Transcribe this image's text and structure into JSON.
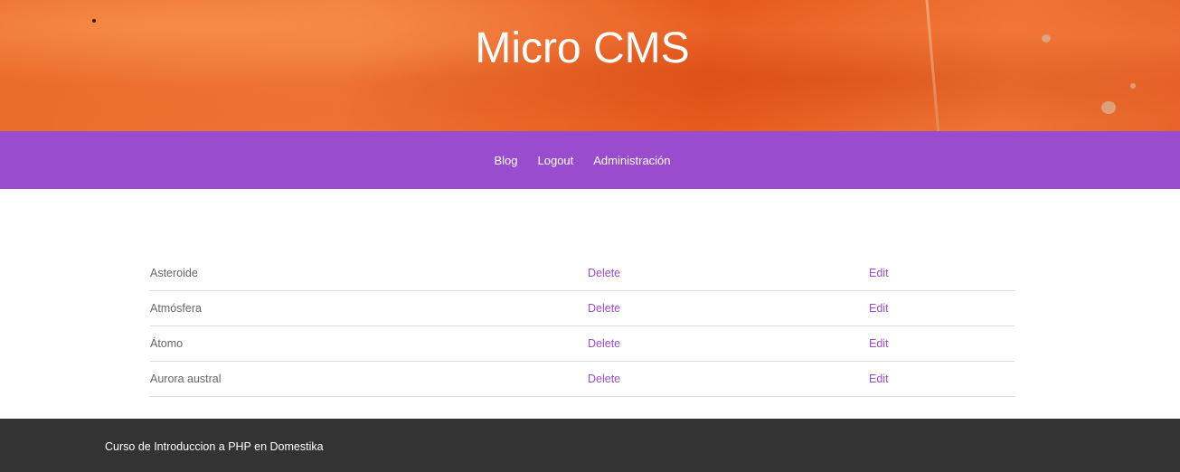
{
  "header": {
    "title": "Micro CMS"
  },
  "nav": {
    "items": [
      {
        "label": "Blog"
      },
      {
        "label": "Logout"
      },
      {
        "label": "Administración"
      }
    ]
  },
  "posts": {
    "rows": [
      {
        "title": "Asteroide",
        "delete_label": "Delete",
        "edit_label": "Edit"
      },
      {
        "title": "Atmósfera",
        "delete_label": "Delete",
        "edit_label": "Edit"
      },
      {
        "title": "Átomo",
        "delete_label": "Delete",
        "edit_label": "Edit"
      },
      {
        "title": "Aurora austral",
        "delete_label": "Delete",
        "edit_label": "Edit"
      }
    ]
  },
  "footer": {
    "text": "Curso de Introduccion a PHP en Domestika"
  },
  "colors": {
    "accent": "#9a4ccf",
    "footer_bg": "#333333",
    "header_bg": "#e8642a"
  }
}
